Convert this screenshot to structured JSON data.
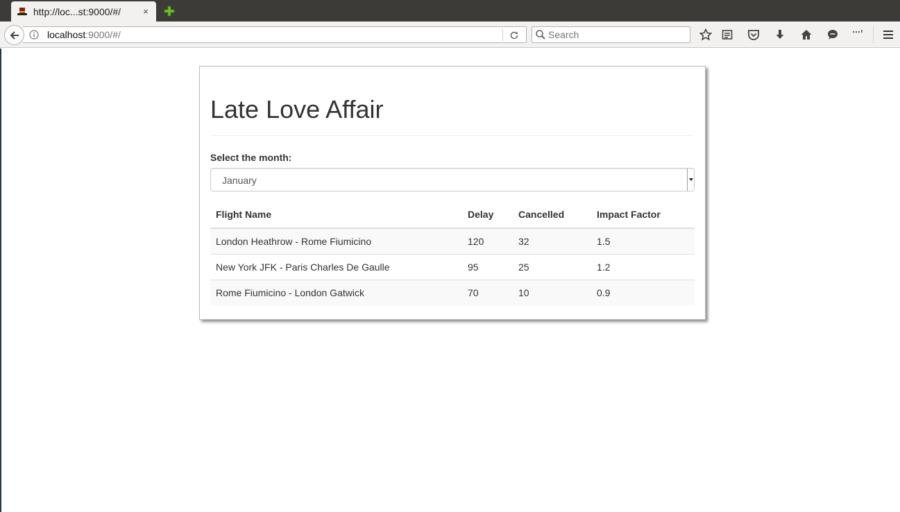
{
  "browser": {
    "tab_title": "http://loc...st:9000/#/",
    "tab_close": "×",
    "url_host": "localhost",
    "url_rest": ":9000/#/",
    "search_placeholder": "Search"
  },
  "page": {
    "title": "Late Love Affair",
    "month_label": "Select the month:",
    "selected_month": "January",
    "table": {
      "headers": [
        "Flight Name",
        "Delay",
        "Cancelled",
        "Impact Factor"
      ],
      "rows": [
        [
          "London Heathrow - Rome Fiumicino",
          "120",
          "32",
          "1.5"
        ],
        [
          "New York JFK - Paris Charles De Gaulle",
          "95",
          "25",
          "1.2"
        ],
        [
          "Rome Fiumicino - London Gatwick",
          "70",
          "10",
          "0.9"
        ]
      ]
    }
  },
  "icons": {
    "favicon": "top-hat-icon",
    "new_tab": "plus-icon",
    "back": "back-arrow-icon",
    "info": "info-icon",
    "reload": "reload-icon",
    "search": "search-icon",
    "bookmark": "star-icon",
    "reading_list": "reading-list-icon",
    "pocket": "pocket-icon",
    "downloads": "download-icon",
    "home": "home-icon",
    "chat": "chat-icon",
    "extension": "extension-icon",
    "menu": "hamburger-menu-icon"
  },
  "colors": {
    "tabstrip": "#3c3b37",
    "toolbar": "#f2f1f0",
    "new_tab_plus": "#6fbf2a",
    "text": "#333333"
  }
}
